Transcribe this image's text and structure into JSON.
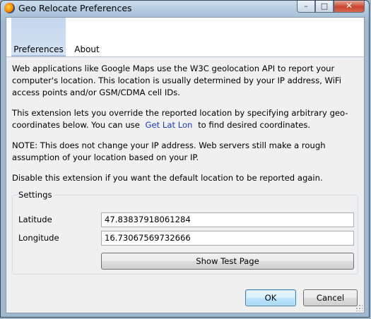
{
  "window": {
    "title": "Geo Relocate Preferences",
    "controls": {
      "minimize": "–",
      "maximize": "□",
      "close": "✕"
    }
  },
  "tabs": [
    {
      "label": "Preferences",
      "active": true
    },
    {
      "label": "About",
      "active": false
    }
  ],
  "content": {
    "para1": "Web applications like Google Maps use the W3C geolocation API to report your computer's location. This location is usually determined by your IP address, WiFi access points and/or GSM/CDMA cell IDs.",
    "para2_before": "This extension lets you override the reported location by specifying arbitrary geo-coordinates below. You can use",
    "para2_link": "Get Lat Lon",
    "para2_after": "to find desired coordinates.",
    "para3": "NOTE: This does not change your IP address. Web servers still make a rough assumption of your location based on your IP.",
    "para4": "Disable this extension if you want the default location to be reported again."
  },
  "settings": {
    "legend": "Settings",
    "latitude_label": "Latitude",
    "latitude_value": "47.83837918061284",
    "longitude_label": "Longitude",
    "longitude_value": "16.73067569732666",
    "test_button": "Show Test Page"
  },
  "footer": {
    "ok": "OK",
    "cancel": "Cancel"
  },
  "colors": {
    "link": "#1a3cc4",
    "active_tab": "#c3d6ee",
    "close_button": "#c8422c"
  },
  "icons": {
    "app": "firefox-icon"
  }
}
